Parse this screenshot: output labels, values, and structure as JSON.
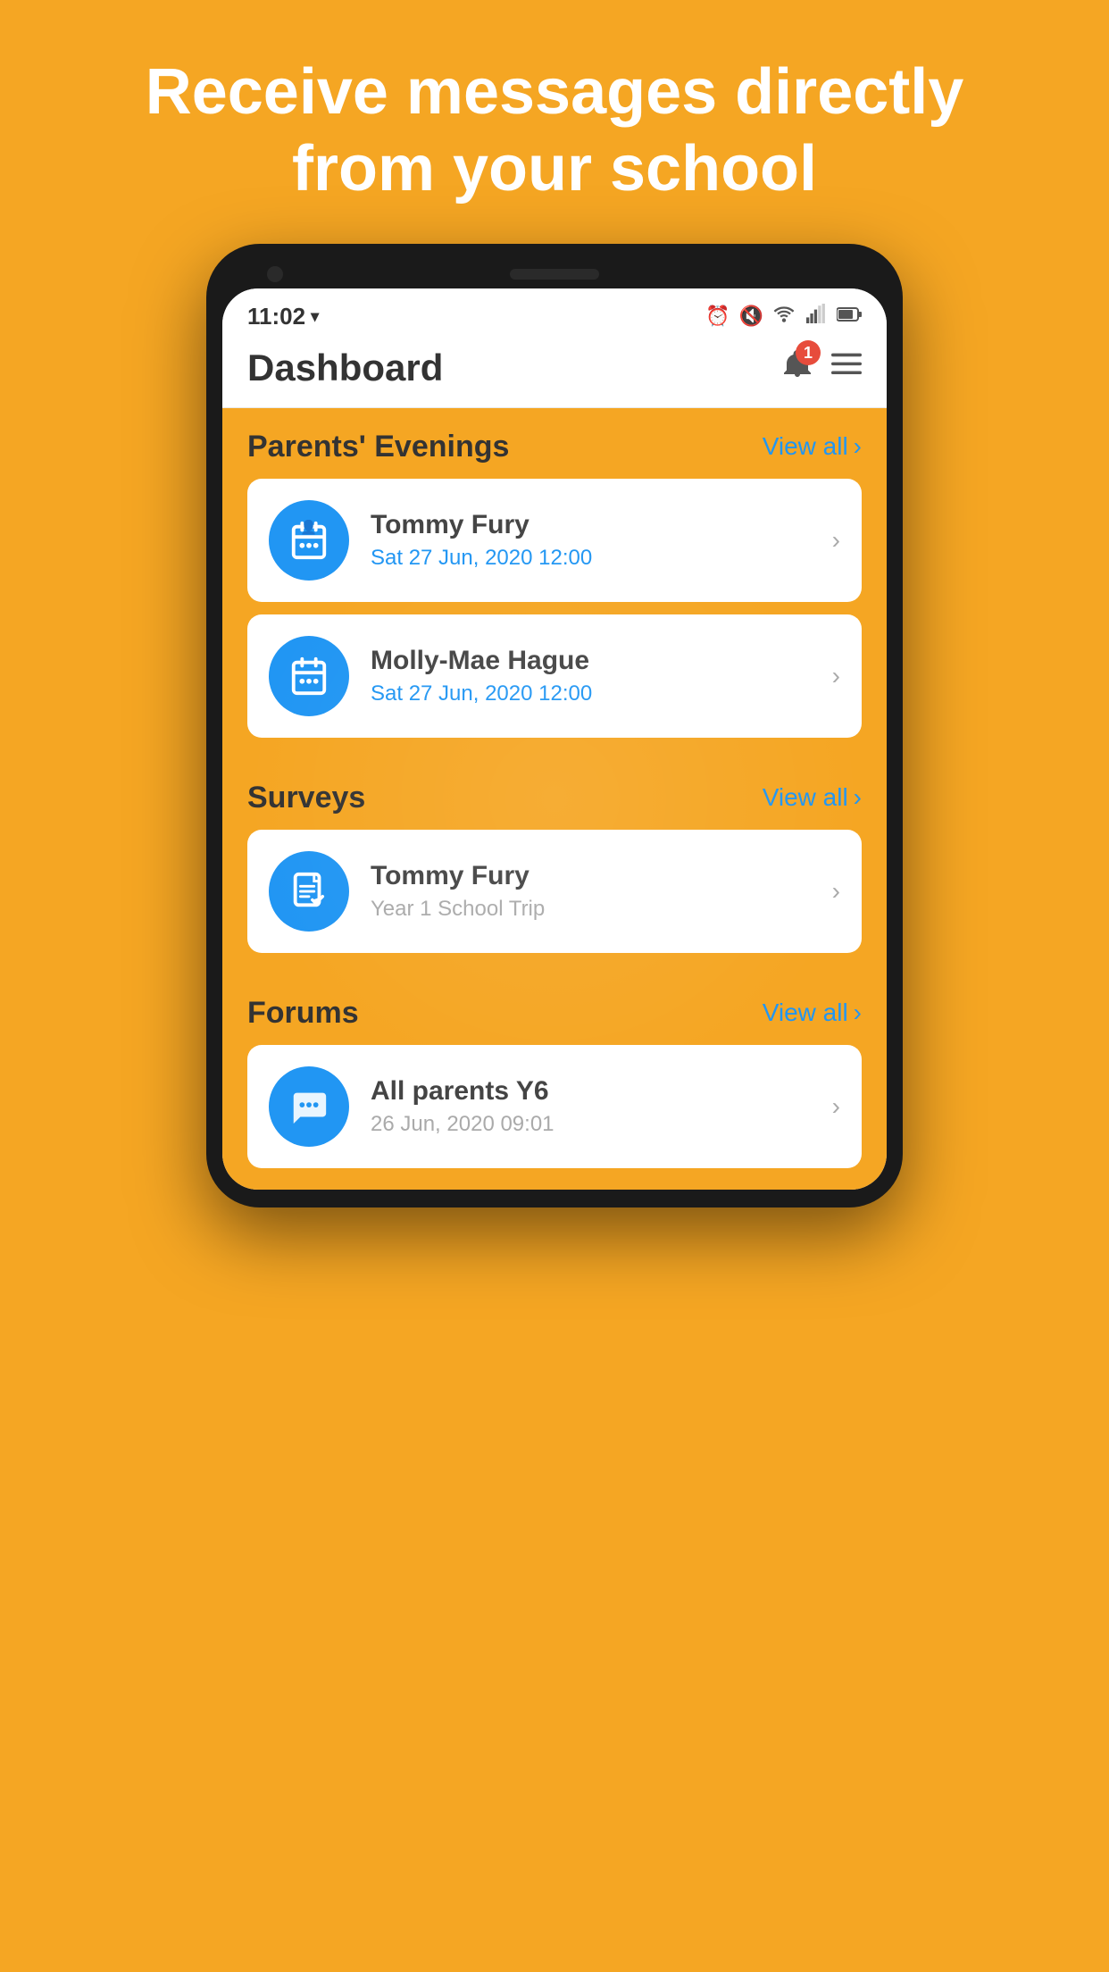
{
  "hero": {
    "text": "Receive messages directly from your school"
  },
  "status_bar": {
    "time": "11:02",
    "time_indicator": "▾",
    "icons": [
      "⏰",
      "🔇",
      "WiFi",
      "Signal",
      "Battery"
    ]
  },
  "app_header": {
    "title": "Dashboard",
    "notification_count": "1",
    "bell_icon": "bell-icon",
    "menu_icon": "menu-icon"
  },
  "sections": [
    {
      "id": "parents-evenings",
      "title": "Parents' Evenings",
      "view_all_label": "View all",
      "items": [
        {
          "name": "Tommy Fury",
          "detail": "Sat 27 Jun, 2020 12:00",
          "icon_type": "calendar"
        },
        {
          "name": "Molly-Mae Hague",
          "detail": "Sat 27 Jun, 2020 12:00",
          "icon_type": "calendar"
        }
      ]
    },
    {
      "id": "surveys",
      "title": "Surveys",
      "view_all_label": "View all",
      "items": [
        {
          "name": "Tommy Fury",
          "detail": "Year 1 School Trip",
          "icon_type": "survey",
          "detail_color": "gray"
        }
      ]
    },
    {
      "id": "forums",
      "title": "Forums",
      "view_all_label": "View all",
      "items": [
        {
          "name": "All parents Y6",
          "detail": "26 Jun, 2020 09:01",
          "icon_type": "chat"
        }
      ]
    }
  ]
}
